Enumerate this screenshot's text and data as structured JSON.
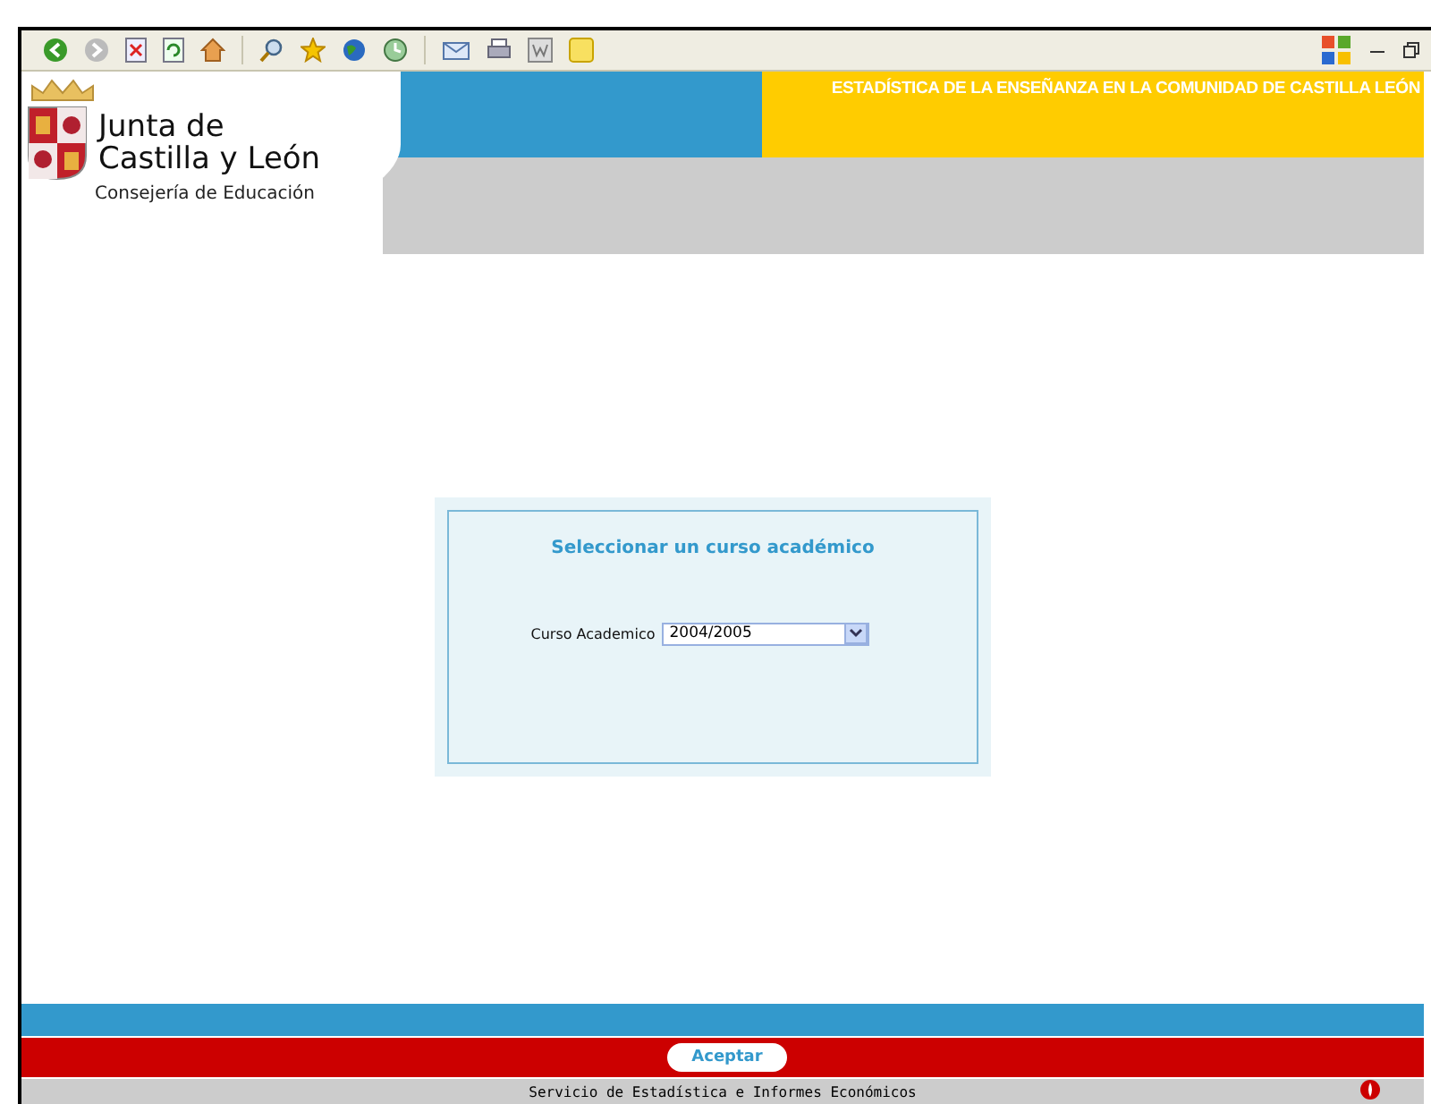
{
  "header": {
    "org_name_line1": "Junta de",
    "org_name_line2": "Castilla y León",
    "department": "Consejería de Educación",
    "banner_title": "ESTADÍSTICA DE LA ENSEÑANZA EN LA COMUNIDAD DE CASTILLA LEÓN"
  },
  "form": {
    "title": "Seleccionar un curso académico",
    "field_label": "Curso Academico",
    "field_value": "2004/2005"
  },
  "footer": {
    "button": "Aceptar",
    "credit": "Servicio de Estadística e Informes Económicos"
  }
}
